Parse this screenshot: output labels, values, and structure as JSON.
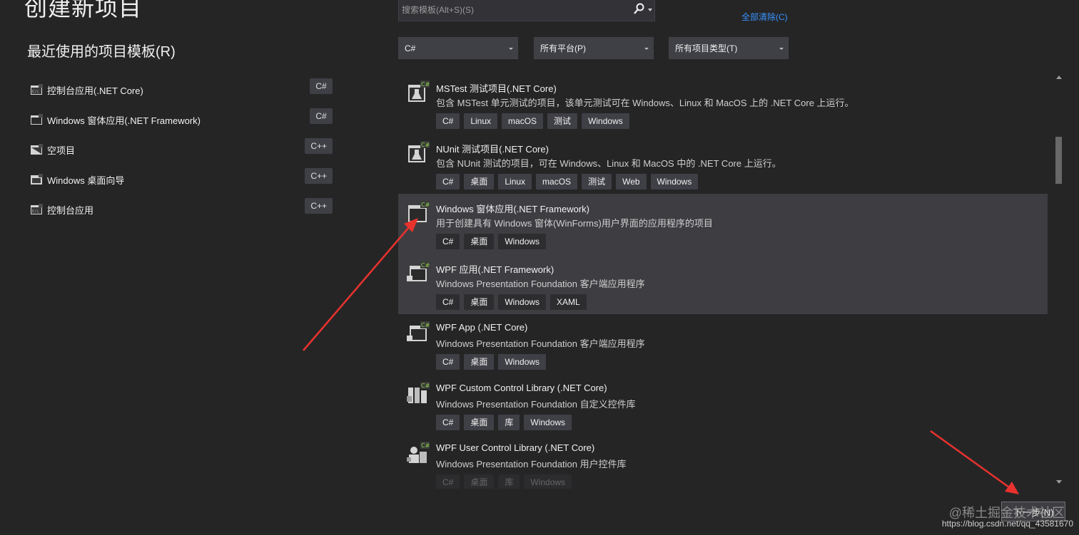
{
  "page": {
    "title": "创建新项目"
  },
  "recent": {
    "title": "最近使用的项目模板(R)",
    "items": [
      {
        "label": "控制台应用(.NET Core)",
        "lang": "C#",
        "icon": "console-app-icon"
      },
      {
        "label": "Windows 窗体应用(.NET Framework)",
        "lang": "C#",
        "icon": "windows-form-icon"
      },
      {
        "label": "空项目",
        "lang": "C++",
        "icon": "empty-project-icon"
      },
      {
        "label": "Windows 桌面向导",
        "lang": "C++",
        "icon": "windows-desktop-icon"
      },
      {
        "label": "控制台应用",
        "lang": "C++",
        "icon": "console-app-icon"
      }
    ]
  },
  "search": {
    "placeholder": "搜索模板(Alt+S)(S)"
  },
  "clear_all": "全部清除(C)",
  "filters": {
    "language": "C#",
    "platform": "所有平台(P)",
    "project_type": "所有项目类型(T)"
  },
  "templates": [
    {
      "name": "MSTest 测试项目(.NET Core)",
      "desc": "包含 MSTest 单元测试的项目，该单元测试可在 Windows、Linux 和 MacOS 上的 .NET Core 上运行。",
      "tags": [
        "C#",
        "Linux",
        "macOS",
        "测试",
        "Windows"
      ],
      "icon": "test-flask-icon"
    },
    {
      "name": "NUnit 测试项目(.NET Core)",
      "desc": "包含 NUnit 测试的项目，可在 Windows、Linux 和 MacOS 中的 .NET Core 上运行。",
      "tags": [
        "C#",
        "桌面",
        "Linux",
        "macOS",
        "测试",
        "Web",
        "Windows"
      ],
      "icon": "test-flask-icon"
    },
    {
      "name": "Windows 窗体应用(.NET Framework)",
      "desc": "用于创建具有 Windows 窗体(WinForms)用户界面的应用程序的项目",
      "tags": [
        "C#",
        "桌面",
        "Windows"
      ],
      "icon": "windows-form-icon"
    },
    {
      "name": "WPF 应用(.NET Framework)",
      "desc": "Windows Presentation Foundation 客户端应用程序",
      "tags": [
        "C#",
        "桌面",
        "Windows",
        "XAML"
      ],
      "icon": "wpf-app-icon"
    },
    {
      "name": "WPF App (.NET Core)",
      "desc": "Windows Presentation Foundation 客户端应用程序",
      "tags": [
        "C#",
        "桌面",
        "Windows"
      ],
      "icon": "wpf-app-icon"
    },
    {
      "name": "WPF Custom Control Library (.NET Core)",
      "desc": "Windows Presentation Foundation 自定义控件库",
      "tags": [
        "C#",
        "桌面",
        "库",
        "Windows"
      ],
      "icon": "control-library-icon"
    },
    {
      "name": "WPF User Control Library (.NET Core)",
      "desc": "Windows Presentation Foundation 用户控件库",
      "tags": [
        "C#",
        "桌面",
        "库",
        "Windows"
      ],
      "icon": "user-control-icon"
    }
  ],
  "next_button": "下一步(N)",
  "watermark": {
    "line1": "@稀土掘金技术社区",
    "line2": "https://blog.csdn.net/qq_43581670"
  },
  "colors": {
    "background": "#252526",
    "accent": "#3794ff",
    "highlight": "#3e3e42",
    "annotation_arrow": "#e8322e"
  }
}
